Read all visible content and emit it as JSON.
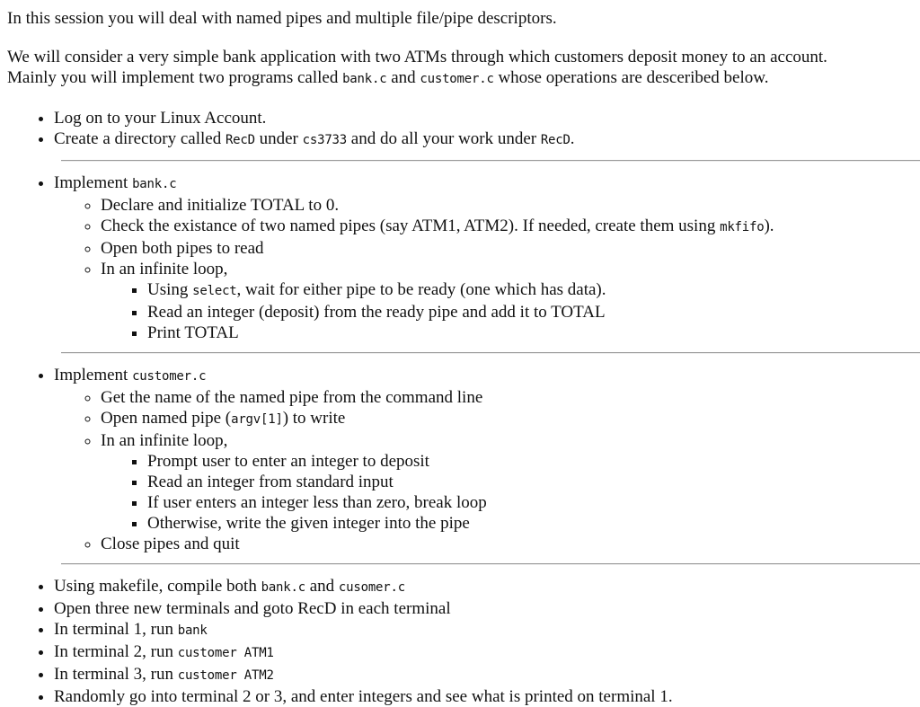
{
  "intro": "In this session you will deal with named pipes and multiple file/pipe descriptors.",
  "description": {
    "line1": "We will consider a very simple bank application with two ATMs through which customers deposit money to an account.",
    "line2_before": "Mainly you will implement two programs called ",
    "line2_code1": "bank.c",
    "line2_mid": " and ",
    "line2_code2": "customer.c",
    "line2_after": " whose operations are desceribed below."
  },
  "setup": {
    "item1": "Log on to your Linux Account.",
    "item2_before": "Create a directory called ",
    "item2_code1": "RecD",
    "item2_mid1": " under ",
    "item2_code2": "cs3733",
    "item2_mid2": " and do all your work under ",
    "item2_code3": "RecD",
    "item2_after": "."
  },
  "bank": {
    "title_prefix": "Implement ",
    "title_code": "bank.c",
    "steps": {
      "s1": "Declare and initialize TOTAL to 0.",
      "s2_before": "Check the existance of two named pipes (say ATM1, ATM2). If needed, create them using ",
      "s2_code": "mkfifo",
      "s2_after": ").",
      "s3": "Open both pipes to read",
      "s4": "In an infinite loop,"
    },
    "loop": {
      "l1_before": "Using ",
      "l1_code": "select",
      "l1_after": ", wait for either pipe to be ready (one which has data).",
      "l2": "Read an integer (deposit) from the ready pipe and add it to TOTAL",
      "l3": "Print TOTAL"
    }
  },
  "customer": {
    "title_prefix": "Implement ",
    "title_code": "customer.c",
    "steps": {
      "s1": "Get the name of the named pipe from the command line",
      "s2_before": "Open named pipe (",
      "s2_code": "argv[1]",
      "s2_after": ") to write",
      "s3": "In an infinite loop,",
      "s4": "Close pipes and quit"
    },
    "loop": {
      "l1": "Prompt user to enter an integer to deposit",
      "l2": "Read an integer from standard input",
      "l3": "If user enters an integer less than zero, break loop",
      "l4": "Otherwise, write the given integer into the pipe"
    }
  },
  "run": {
    "r1_before": "Using makefile, compile both ",
    "r1_code1": "bank.c",
    "r1_mid": " and ",
    "r1_code2": "cusomer.c",
    "r2": "Open three new terminals and goto RecD in each terminal",
    "r3_before": "In terminal 1, run ",
    "r3_code": "bank",
    "r4_before": "In terminal 2, run ",
    "r4_code": "customer ATM1",
    "r5_before": "In terminal 3, run ",
    "r5_code": "customer ATM2",
    "r6": "Randomly go into terminal 2 or 3, and enter integers and see what is printed on terminal 1."
  }
}
